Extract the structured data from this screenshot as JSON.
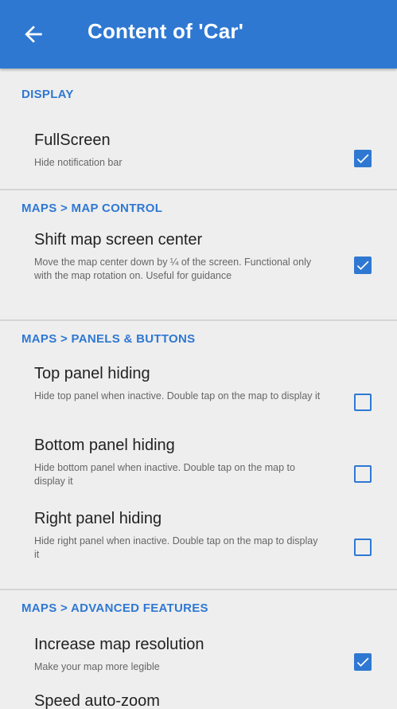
{
  "header": {
    "title": "Content of 'Car'"
  },
  "icons": {
    "back": "arrow-left-icon",
    "check": "checkbox-check-icon"
  },
  "colors": {
    "accent": "#2f78d2",
    "background": "#eeeeee",
    "divider": "#d5d5d5"
  },
  "sections": [
    {
      "title": "DISPLAY",
      "items": [
        {
          "title": "FullScreen",
          "subtitle": "Hide notification bar",
          "checked": true
        }
      ]
    },
    {
      "title": "MAPS > MAP CONTROL",
      "items": [
        {
          "title": "Shift map screen center",
          "subtitle": "Move the map center down by ¼ of the screen. Functional only with the map rotation on. Useful for guidance",
          "checked": true
        }
      ]
    },
    {
      "title": "MAPS > PANELS & BUTTONS",
      "items": [
        {
          "title": "Top panel hiding",
          "subtitle": "Hide top panel when inactive. Double tap on the map to display it",
          "checked": false
        },
        {
          "title": "Bottom panel hiding",
          "subtitle": "Hide bottom panel when inactive. Double tap on the map to display it",
          "checked": false
        },
        {
          "title": "Right panel hiding",
          "subtitle": "Hide right panel when inactive. Double tap on the map to display it",
          "checked": false
        }
      ]
    },
    {
      "title": "MAPS > ADVANCED FEATURES",
      "items": [
        {
          "title": "Increase map resolution",
          "subtitle": "Make your map more legible",
          "checked": true
        },
        {
          "title": "Speed auto-zoom",
          "subtitle": "",
          "checked": true
        }
      ]
    }
  ]
}
